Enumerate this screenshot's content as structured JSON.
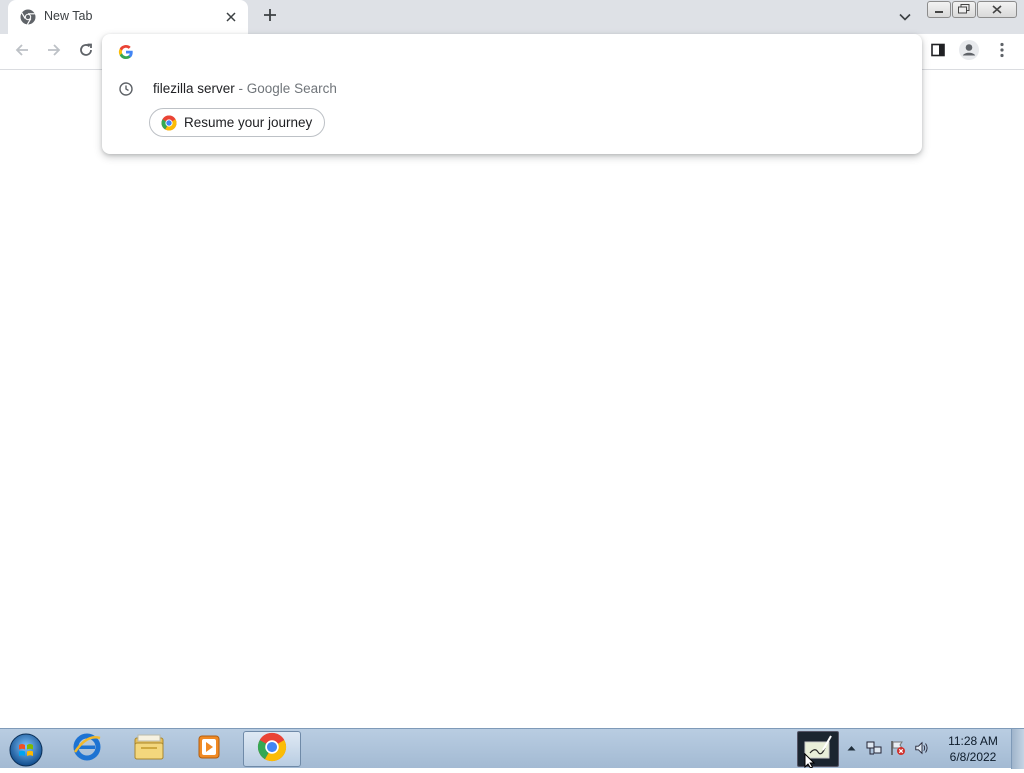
{
  "tab": {
    "title": "New Tab",
    "favicon": "chrome-icon",
    "close_icon": "close-icon"
  },
  "toolbar": {
    "back_icon": "back-arrow-icon",
    "forward_icon": "forward-arrow-icon",
    "reload_icon": "reload-icon",
    "sidepanel_icon": "side-panel-icon",
    "profile_icon": "profile-avatar-icon",
    "menu_icon": "kebab-menu-icon"
  },
  "omnibox": {
    "value": "",
    "placeholder": "",
    "engine_icon": "google-g-icon",
    "suggestion": {
      "query": "filezilla server",
      "separator": " - ",
      "engine": "Google Search",
      "icon": "history-clock-icon"
    },
    "journey_chip": {
      "label": "Resume your journey",
      "icon": "chrome-icon"
    }
  },
  "taskbar": {
    "apps": [
      {
        "name": "internet-explorer",
        "icon": "ie-icon"
      },
      {
        "name": "file-explorer",
        "icon": "folder-icon"
      },
      {
        "name": "media-player",
        "icon": "media-player-icon"
      },
      {
        "name": "chrome",
        "icon": "chrome-icon",
        "active": true
      }
    ],
    "clock": {
      "time": "11:28 AM",
      "date": "6/8/2022"
    }
  },
  "colors": {
    "tabstrip_bg": "#dee1e6",
    "taskbar_bg": "#b9cde2",
    "text_primary": "#202124",
    "text_secondary": "#70757a",
    "google_blue": "#4285f4",
    "google_red": "#ea4335",
    "google_yellow": "#fbbc05",
    "google_green": "#34a853"
  }
}
